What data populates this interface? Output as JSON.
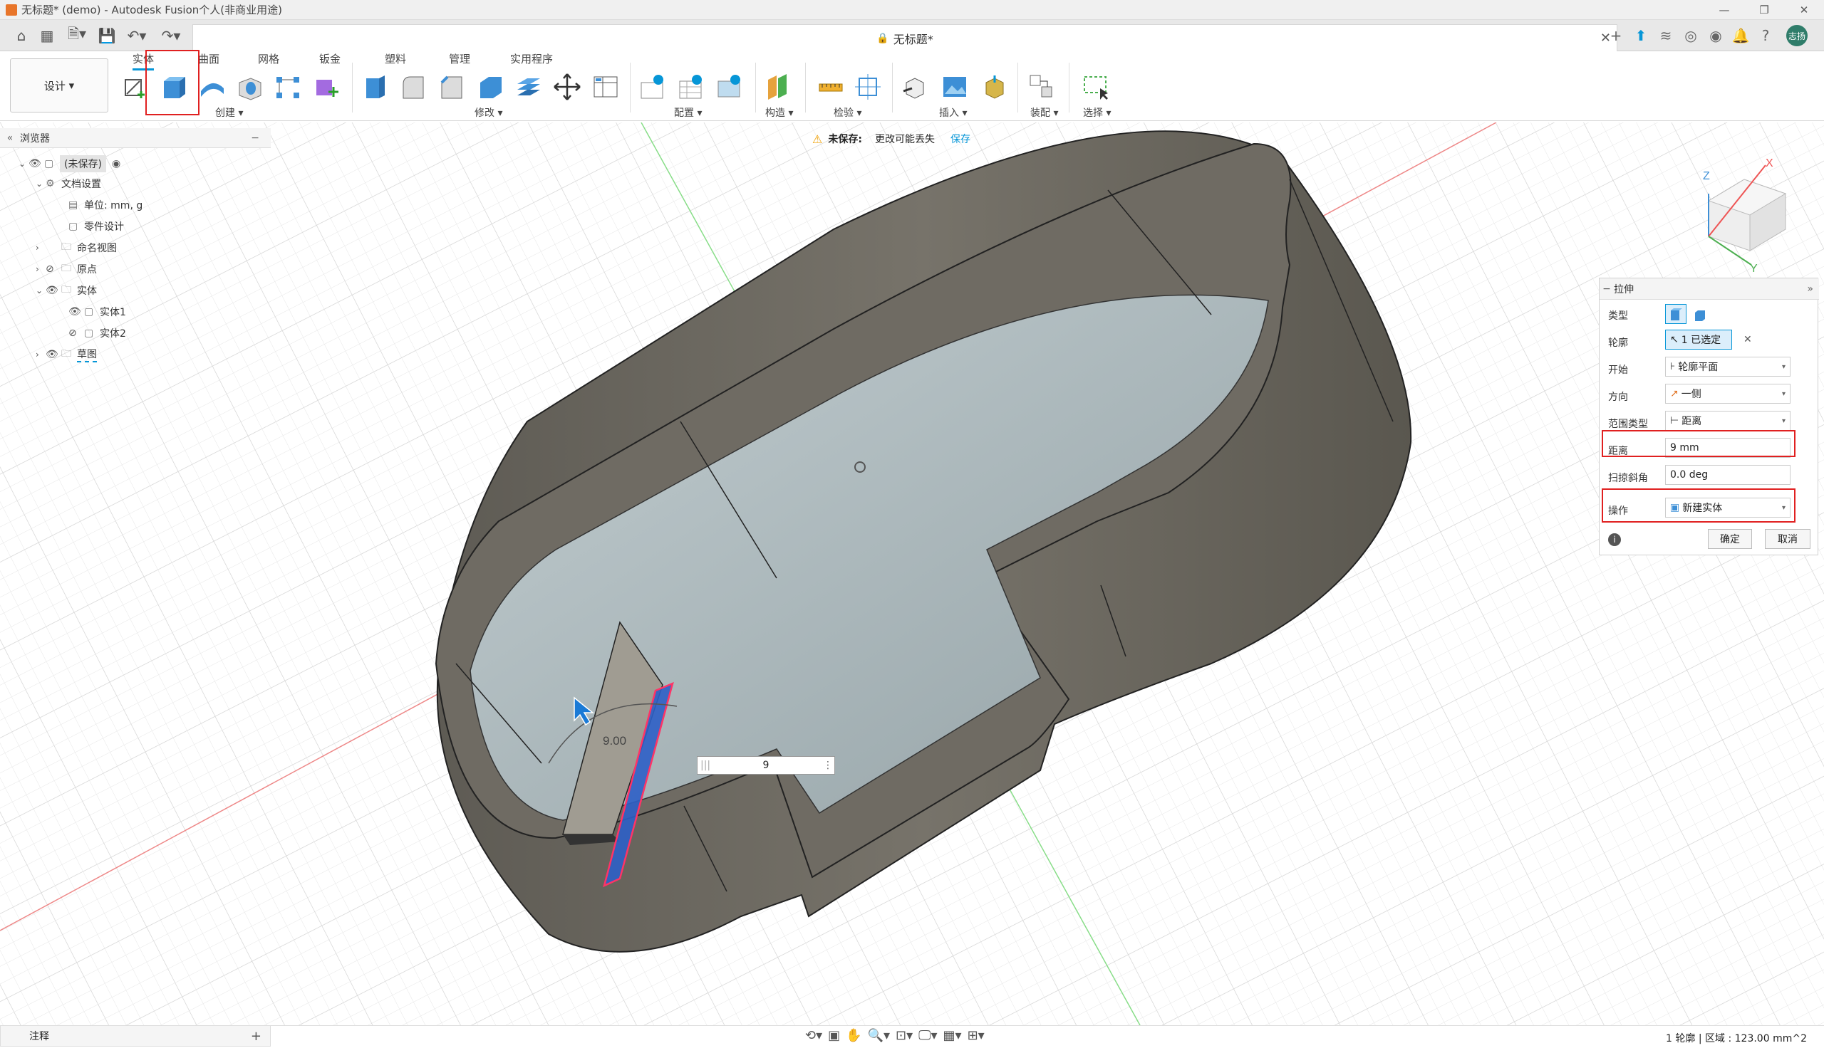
{
  "title_bar": {
    "title": "无标题* (demo) - Autodesk Fusion个人(非商业用途)"
  },
  "doc_tab": {
    "title": "无标题*"
  },
  "user": {
    "initials": "志扬"
  },
  "toolbar": {
    "design_label": "设计",
    "tabs": [
      "实体",
      "曲面",
      "网格",
      "钣金",
      "塑料",
      "管理",
      "实用程序"
    ],
    "groups": {
      "create": "创建",
      "modify": "修改",
      "configure": "配置",
      "construct": "构造",
      "inspect": "检验",
      "insert": "插入",
      "assemble": "装配",
      "select": "选择"
    }
  },
  "browser": {
    "title": "浏览器",
    "root": "(未保存)",
    "doc_settings": "文档设置",
    "units": "单位: mm, g",
    "part_design": "零件设计",
    "named_views": "命名视图",
    "origin": "原点",
    "bodies": "实体",
    "body1": "实体1",
    "body2": "实体2",
    "sketches": "草图"
  },
  "notice": {
    "label": "未保存:",
    "message": "更改可能丢失",
    "save_link": "保存"
  },
  "extrude_panel": {
    "title": "拉伸",
    "rows": {
      "type": "类型",
      "profile": "轮廓",
      "profile_value": "1 已选定",
      "start": "开始",
      "start_value": "轮廓平面",
      "direction": "方向",
      "direction_value": "一侧",
      "extent_type": "范围类型",
      "extent_value": "距离",
      "distance": "距离",
      "distance_value": "9 mm",
      "taper": "扫掠斜角",
      "taper_value": "0.0 deg",
      "operation": "操作",
      "operation_value": "新建实体"
    },
    "ok": "确定",
    "cancel": "取消"
  },
  "viewport": {
    "dim_label": "9.00",
    "dim_input": "9"
  },
  "notes": {
    "label": "注释"
  },
  "status": {
    "text": "1 轮廓 | 区域 : 123.00 mm^2"
  },
  "colors": {
    "accent": "#0696d7",
    "highlight_red": "#e02020",
    "body_dark": "#6b6860",
    "floor": "#a7b4b8"
  }
}
